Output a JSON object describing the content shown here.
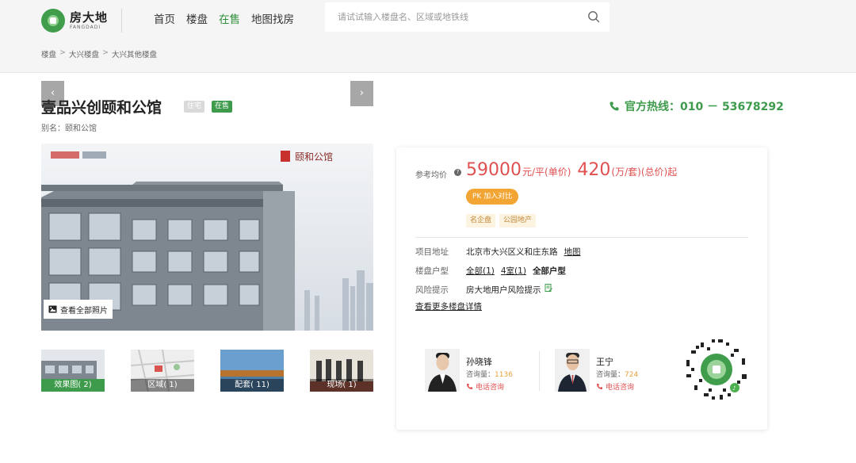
{
  "brand": {
    "name_cn": "房大地",
    "name_en": "FANGDADI"
  },
  "nav": {
    "items": [
      {
        "label": "首页"
      },
      {
        "label": "楼盘"
      },
      {
        "label": "在售"
      },
      {
        "label": "地图找房"
      }
    ],
    "active_index": 2
  },
  "search": {
    "placeholder": "请试试输入楼盘名、区域或地铁线"
  },
  "breadcrumb": [
    "楼盘",
    "大兴楼盘",
    "大兴其他楼盘"
  ],
  "project": {
    "title": "壹品兴创颐和公馆",
    "type_tag": "住宅",
    "status_tag": "在售",
    "alias": "别名：颐和公馆"
  },
  "hotline": {
    "text": "官方热线：010 － 53678292"
  },
  "gallery": {
    "view_all": "查看全部照片",
    "thumbs": [
      {
        "label": "效果图( 2)"
      },
      {
        "label": "区域( 1)"
      },
      {
        "label": "配套( 11)"
      },
      {
        "label": "现场( 1)"
      }
    ],
    "banner_text": "颐和公馆"
  },
  "price": {
    "label": "参考均价",
    "avg": "59000",
    "avg_unit": "元/平(单价)",
    "total": "420",
    "total_unit": "(万/套)(总价)起",
    "pk_button": "PK 加入对比",
    "features": [
      "名企盘",
      "公园地产"
    ]
  },
  "info": {
    "address_key": "项目地址",
    "address_val": "北京市大兴区义和庄东路",
    "map_link": "地图",
    "layout_key": "楼盘户型",
    "layout_all": "全部(1)",
    "layout_4": "4室(1)",
    "layout_full": "全部户型",
    "risk_key": "风险提示",
    "risk_val": "房大地用户风险提示",
    "more_link": "查看更多楼盘详情"
  },
  "agents": [
    {
      "name": "孙晓锋",
      "count_label": "咨询量：",
      "count": "1136",
      "call": "电话咨询"
    },
    {
      "name": "王宁",
      "count_label": "咨询量：",
      "count": "724",
      "call": "电话咨询"
    }
  ],
  "colors": {
    "brand_green": "#3e9b4c",
    "price_red": "#e05050",
    "pk_orange": "#f2a533"
  }
}
